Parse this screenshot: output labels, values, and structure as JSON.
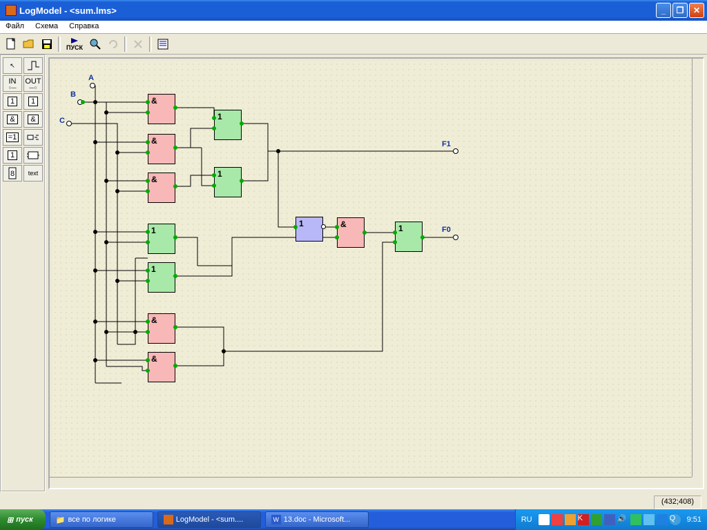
{
  "window": {
    "title": "LogModel - <sum.lms>"
  },
  "menu": {
    "file": "Файл",
    "schema": "Схема",
    "help": "Справка"
  },
  "toolbar": {
    "run_label": "ПУСК"
  },
  "lefttools": {
    "in": "IN",
    "out": "OUT",
    "text": "text"
  },
  "canvas": {
    "inputs": {
      "a": "A",
      "b": "B",
      "c": "C"
    },
    "outputs": {
      "f1": "F1",
      "f0": "F0"
    },
    "gates": {
      "and_sym": "&",
      "or_sym": "1",
      "not_sym": "1"
    }
  },
  "status": {
    "coords": "(432;408)"
  },
  "taskbar": {
    "start": "пуск",
    "task1": "все по логике",
    "task2": "LogModel - <sum....",
    "task3": "13.doc - Microsoft...",
    "lang": "RU",
    "clock": "9:51"
  }
}
